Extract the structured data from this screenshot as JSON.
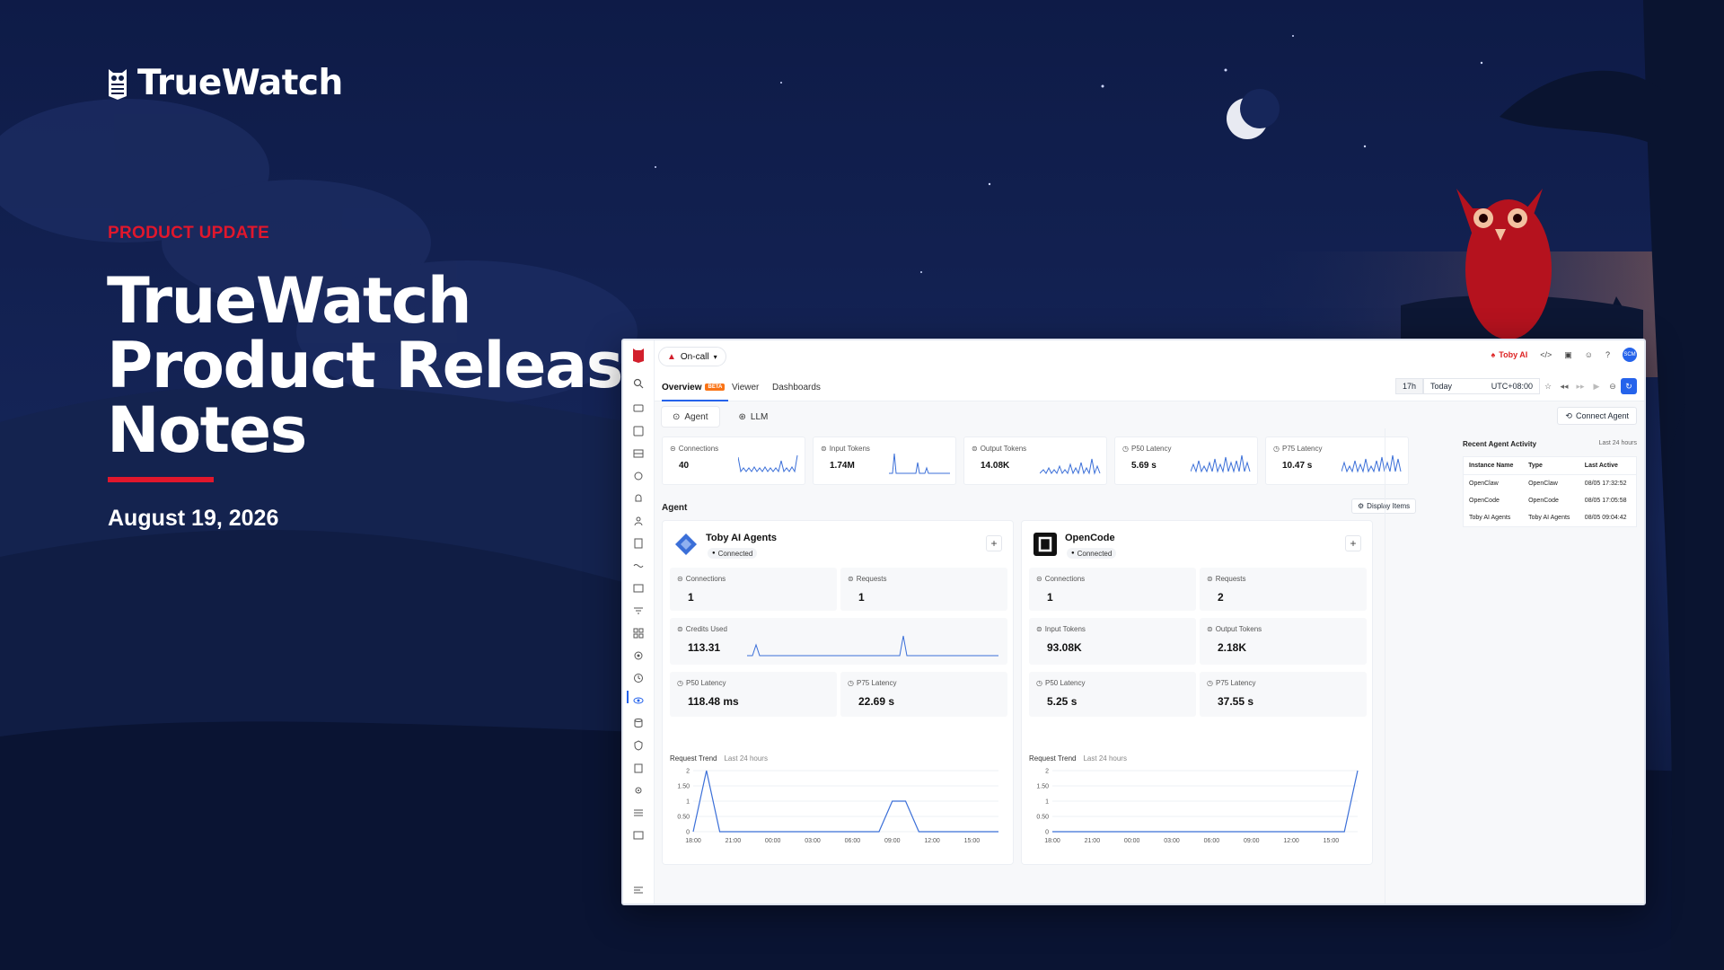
{
  "brand": {
    "name": "TrueWatch"
  },
  "hero": {
    "kicker": "PRODUCT UPDATE",
    "title_lines": [
      "TrueWatch",
      "Product Release",
      "Notes"
    ],
    "date": "August 19, 2026",
    "accent_color": "#e1172c"
  },
  "app": {
    "topbar": {
      "oncall": "On-call",
      "user": "Toby AI",
      "avatar": "SCM"
    },
    "tabs": [
      {
        "label": "Overview",
        "badge": "BETA"
      },
      {
        "label": "Viewer"
      },
      {
        "label": "Dashboards"
      }
    ],
    "timebar": {
      "range": "17h",
      "preset": "Today",
      "timezone": "UTC+08:00"
    },
    "subtabs": [
      {
        "label": "Agent"
      },
      {
        "label": "LLM"
      }
    ],
    "connect_agent": "Connect Agent",
    "kpis": [
      {
        "label": "Connections",
        "value": "40"
      },
      {
        "label": "Input Tokens",
        "value": "1.74M"
      },
      {
        "label": "Output Tokens",
        "value": "14.08K"
      },
      {
        "label": "P50 Latency",
        "value": "5.69 s"
      },
      {
        "label": "P75 Latency",
        "value": "10.47 s"
      }
    ],
    "agent_section": {
      "title": "Agent",
      "display_items": "Display Items"
    },
    "agents": [
      {
        "name": "Toby AI Agents",
        "status": "Connected",
        "metrics": [
          {
            "label": "Connections",
            "value": "1"
          },
          {
            "label": "Requests",
            "value": "1"
          },
          {
            "label": "Credits Used",
            "value": "113.31"
          },
          {
            "label": "P50 Latency",
            "value": "118.48 ms"
          },
          {
            "label": "P75 Latency",
            "value": "22.69 s"
          }
        ],
        "trend": {
          "title": "Request Trend",
          "subtitle": "Last 24 hours"
        }
      },
      {
        "name": "OpenCode",
        "status": "Connected",
        "metrics": [
          {
            "label": "Connections",
            "value": "1"
          },
          {
            "label": "Requests",
            "value": "2"
          },
          {
            "label": "Input Tokens",
            "value": "93.08K"
          },
          {
            "label": "Output Tokens",
            "value": "2.18K"
          },
          {
            "label": "P50 Latency",
            "value": "5.25 s"
          },
          {
            "label": "P75 Latency",
            "value": "37.55 s"
          }
        ],
        "trend": {
          "title": "Request Trend",
          "subtitle": "Last 24 hours"
        }
      }
    ],
    "recent": {
      "title": "Recent Agent Activity",
      "subtitle": "Last 24 hours",
      "columns": [
        "Instance Name",
        "Type",
        "Last Active"
      ],
      "rows": [
        [
          "OpenClaw",
          "OpenClaw",
          "08/05 17:32:52"
        ],
        [
          "OpenCode",
          "OpenCode",
          "08/05 17:05:58"
        ],
        [
          "Toby AI Agents",
          "Toby AI Agents",
          "08/05 09:04:42"
        ]
      ]
    }
  },
  "chart_data": [
    {
      "type": "line",
      "title": "Request Trend",
      "subtitle": "Last 24 hours",
      "x": [
        "18:00",
        "19:00",
        "20:00",
        "21:00",
        "22:00",
        "23:00",
        "00:00",
        "01:00",
        "02:00",
        "03:00",
        "04:00",
        "05:00",
        "06:00",
        "07:00",
        "08:00",
        "09:00",
        "10:00",
        "11:00",
        "12:00",
        "13:00",
        "14:00",
        "15:00",
        "16:00",
        "17:00"
      ],
      "xticks": [
        "18:00",
        "21:00",
        "00:00",
        "03:00",
        "06:00",
        "09:00",
        "12:00",
        "15:00"
      ],
      "yticks": [
        "0",
        "0.50",
        "1",
        "1.50",
        "2"
      ],
      "ylim": [
        0,
        2
      ],
      "series": [
        {
          "values": [
            0,
            2,
            0,
            0,
            0,
            0,
            0,
            0,
            0,
            0,
            0,
            0,
            0,
            0,
            0,
            1,
            1,
            0,
            0,
            0,
            0,
            0,
            0,
            0
          ]
        }
      ],
      "color": "#3b6fd8"
    },
    {
      "type": "line",
      "title": "Request Trend",
      "subtitle": "Last 24 hours",
      "x": [
        "18:00",
        "19:00",
        "20:00",
        "21:00",
        "22:00",
        "23:00",
        "00:00",
        "01:00",
        "02:00",
        "03:00",
        "04:00",
        "05:00",
        "06:00",
        "07:00",
        "08:00",
        "09:00",
        "10:00",
        "11:00",
        "12:00",
        "13:00",
        "14:00",
        "15:00",
        "16:00",
        "17:00"
      ],
      "xticks": [
        "18:00",
        "21:00",
        "00:00",
        "03:00",
        "06:00",
        "09:00",
        "12:00",
        "15:00"
      ],
      "yticks": [
        "0",
        "0.50",
        "1",
        "1.50",
        "2"
      ],
      "ylim": [
        0,
        2
      ],
      "series": [
        {
          "values": [
            0,
            0,
            0,
            0,
            0,
            0,
            0,
            0,
            0,
            0,
            0,
            0,
            0,
            0,
            0,
            0,
            0,
            0,
            0,
            0,
            0,
            0,
            0,
            2
          ]
        }
      ],
      "color": "#3b6fd8"
    }
  ],
  "icons": {
    "brand": "owl-logo-icon",
    "moon": "crescent-moon-icon",
    "owl": "red-owl-illustration"
  }
}
